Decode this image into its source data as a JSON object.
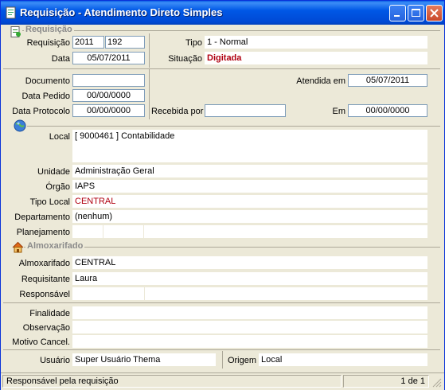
{
  "window": {
    "title": "Requisição - Atendimento Direto Simples"
  },
  "sections": {
    "requisicao": "Requisição",
    "almoxarifado": "Almoxarifado"
  },
  "header": {
    "requisicao_label": "Requisição",
    "requisicao_ano": "2011",
    "requisicao_num": "192",
    "data_label": "Data",
    "data": "05/07/2011",
    "tipo_label": "Tipo",
    "tipo": "1  -  Normal",
    "situacao_label": "Situação",
    "situacao": "Digitada"
  },
  "docs": {
    "documento_label": "Documento",
    "documento": "",
    "data_pedido_label": "Data Pedido",
    "data_pedido": "00/00/0000",
    "data_protocolo_label": "Data Protocolo",
    "data_protocolo": "00/00/0000",
    "atendida_em_label": "Atendida em",
    "atendida_em": "05/07/2011",
    "recebida_por_label": "Recebida por",
    "recebida_por": "",
    "em_label": "Em",
    "em": "00/00/0000"
  },
  "local": {
    "local_label": "Local",
    "local": "[ 9000461 ] Contabilidade",
    "unidade_label": "Unidade",
    "unidade": "Administração Geral",
    "orgao_label": "Órgão",
    "orgao": "IAPS",
    "tipo_local_label": "Tipo Local",
    "tipo_local": "CENTRAL",
    "departamento_label": "Departamento",
    "departamento": "(nenhum)",
    "planejamento_label": "Planejamento"
  },
  "almox": {
    "almoxarifado_label": "Almoxarifado",
    "almoxarifado": "CENTRAL",
    "requisitante_label": "Requisitante",
    "requisitante": "Laura",
    "responsavel_label": "Responsável"
  },
  "obs": {
    "finalidade_label": "Finalidade",
    "observacao_label": "Observação",
    "motivo_label": "Motivo Cancel."
  },
  "footer": {
    "usuario_label": "Usuário",
    "usuario": "Super Usuário Thema",
    "origem_label": "Origem",
    "origem": "Local"
  },
  "status": {
    "message": "Responsável pela requisição",
    "page": "1 de 1"
  },
  "icons": {
    "title": "document-icon",
    "requisicao": "document-icon",
    "local": "globe-icon",
    "almoxarifado": "house-icon"
  },
  "colors": {
    "titlebar": "#0058e6",
    "highlight_text": "#b00010",
    "window_bg": "#ece9d8"
  }
}
